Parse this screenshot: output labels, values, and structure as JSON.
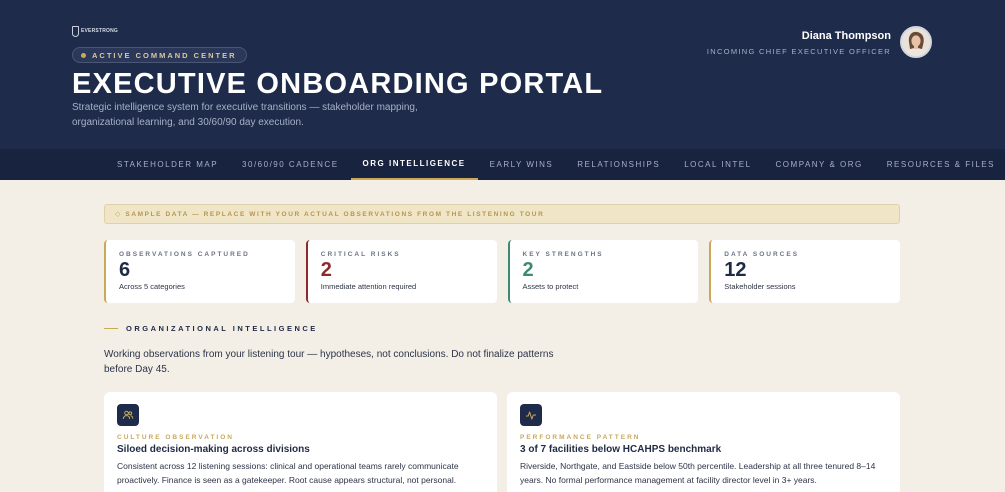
{
  "header": {
    "logo_text": "EVERSTRONG",
    "badge": "ACTIVE COMMAND CENTER",
    "title": "EXECUTIVE ONBOARDING PORTAL",
    "subtitle": "Strategic intelligence system for executive transitions — stakeholder mapping, organizational learning, and 30/60/90 day execution."
  },
  "user": {
    "name": "Diana Thompson",
    "role": "INCOMING CHIEF EXECUTIVE OFFICER"
  },
  "tabs": [
    {
      "label": "STAKEHOLDER MAP",
      "active": false
    },
    {
      "label": "30/60/90 CADENCE",
      "active": false
    },
    {
      "label": "ORG INTELLIGENCE",
      "active": true
    },
    {
      "label": "EARLY WINS",
      "active": false
    },
    {
      "label": "RELATIONSHIPS",
      "active": false
    },
    {
      "label": "LOCAL INTEL",
      "active": false
    },
    {
      "label": "COMPANY & ORG",
      "active": false
    },
    {
      "label": "RESOURCES & FILES",
      "active": false
    }
  ],
  "banner": {
    "icon": "◇",
    "text": "SAMPLE DATA — REPLACE WITH YOUR ACTUAL OBSERVATIONS FROM THE LISTENING TOUR"
  },
  "stats": [
    {
      "label": "OBSERVATIONS CAPTURED",
      "value": "6",
      "sub": "Across 5 categories"
    },
    {
      "label": "CRITICAL RISKS",
      "value": "2",
      "sub": "Immediate attention required"
    },
    {
      "label": "KEY STRENGTHS",
      "value": "2",
      "sub": "Assets to protect"
    },
    {
      "label": "DATA SOURCES",
      "value": "12",
      "sub": "Stakeholder sessions"
    }
  ],
  "section": {
    "title": "ORGANIZATIONAL INTELLIGENCE",
    "description": "Working observations from your listening tour — hypotheses, not conclusions. Do not finalize patterns before Day 45."
  },
  "cards": [
    {
      "icon": "people-icon",
      "kicker": "CULTURE OBSERVATION",
      "title": "Siloed decision-making across divisions",
      "body": "Consistent across 12 listening sessions: clinical and operational teams rarely communicate proactively. Finance is seen as a gatekeeper. Root cause appears structural, not personal."
    },
    {
      "icon": "pulse-icon",
      "kicker": "PERFORMANCE PATTERN",
      "title": "3 of 7 facilities below HCAHPS benchmark",
      "body": "Riverside, Northgate, and Eastside below 50th percentile. Leadership at all three tenured 8–14 years. No formal performance management at facility director level in 3+ years."
    }
  ],
  "colors": {
    "navy": "#1e2b4b",
    "gold": "#c9a85a",
    "risk": "#8b2b2b",
    "strength": "#3e8a6e",
    "background": "#f3efe7"
  }
}
